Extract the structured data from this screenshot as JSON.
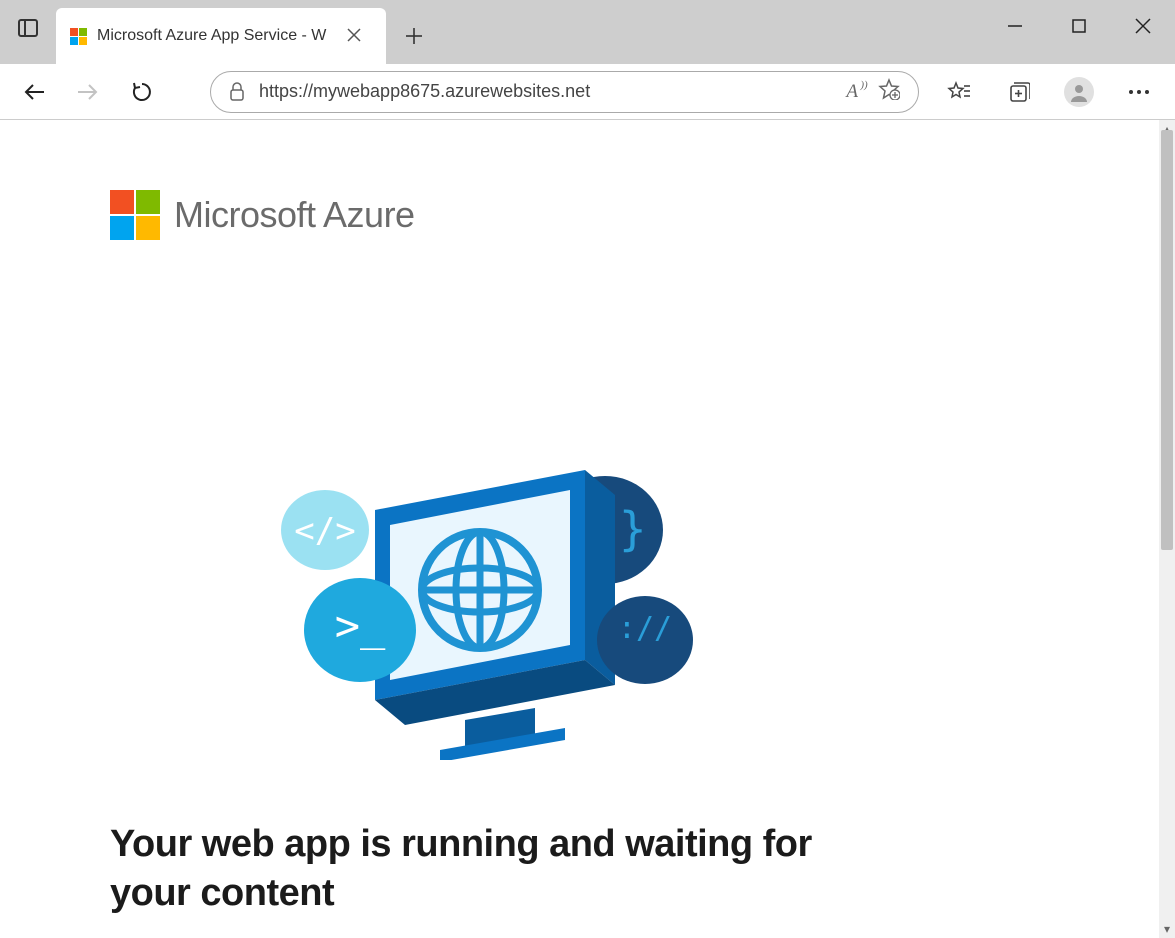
{
  "browser": {
    "tab_title": "Microsoft Azure App Service - W",
    "url": "https://mywebapp8675.azurewebsites.net"
  },
  "page": {
    "brand": "Microsoft Azure",
    "headline": "Your web app is running and waiting for your content"
  },
  "colors": {
    "ms_red": "#f25022",
    "ms_green": "#7fba00",
    "ms_blue": "#00a4ef",
    "ms_yellow": "#ffb900"
  }
}
